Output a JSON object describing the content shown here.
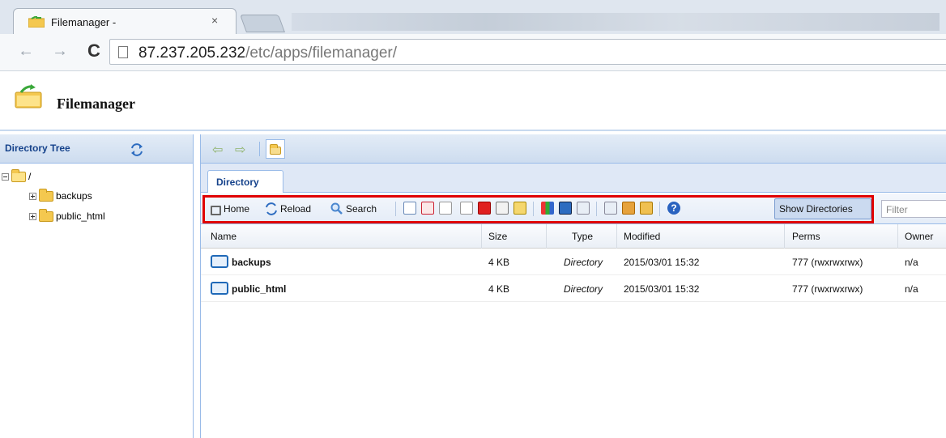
{
  "browser": {
    "tab_title": "Filemanager -",
    "tab_close": "×",
    "url_host": "87.237.205.232",
    "url_path": "/etc/apps/filemanager/"
  },
  "app": {
    "title": "Filemanager"
  },
  "tree": {
    "title": "Directory Tree",
    "root": "/",
    "items": [
      "backups",
      "public_html"
    ]
  },
  "main": {
    "tab_label": "Directory",
    "toolbar": {
      "home": "Home",
      "reload": "Reload",
      "search": "Search",
      "show_directories": "Show Directories",
      "filter_placeholder": "Filter"
    },
    "columns": [
      "Name",
      "Size",
      "Type",
      "Modified",
      "Perms",
      "Owner"
    ],
    "rows": [
      {
        "name": "backups",
        "size": "4 KB",
        "type": "Directory",
        "modified": "2015/03/01 15:32",
        "perms": "777 (rwxrwxrwx)",
        "owner": "n/a"
      },
      {
        "name": "public_html",
        "size": "4 KB",
        "type": "Directory",
        "modified": "2015/03/01 15:32",
        "perms": "777 (rwxrwxrwx)",
        "owner": "n/a"
      }
    ]
  },
  "colors": {
    "highlight": "#e00000",
    "panel_header": "#15428b",
    "border": "#99bbe8"
  }
}
